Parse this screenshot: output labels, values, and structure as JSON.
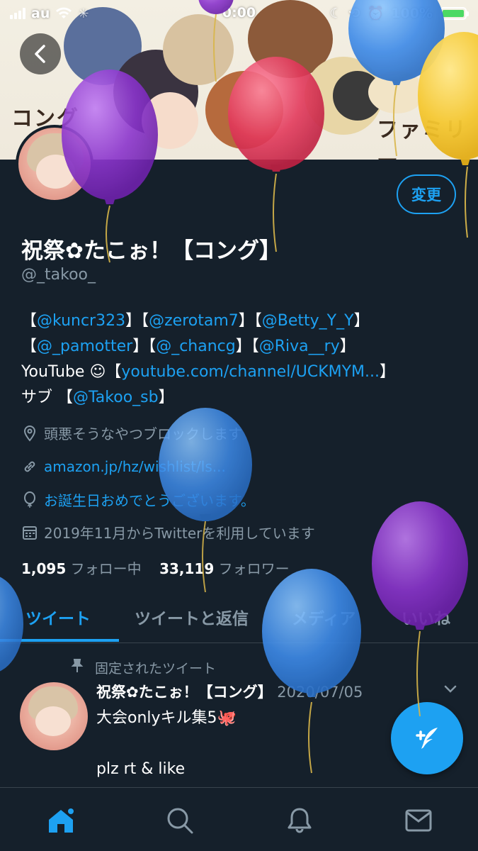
{
  "status_bar": {
    "carrier": "au",
    "time": "0:00",
    "battery": "100%",
    "battery_fill": 1.0
  },
  "banner": {
    "text_left": "コング",
    "text_right": "ファミリー"
  },
  "profile": {
    "name": "祝祭✿たこぉ！【コング】",
    "handle": "@_takoo_",
    "edit_button": "変更",
    "bio": {
      "line1": [
        {
          "t": "【",
          "link": false
        },
        {
          "t": "@kuncr323",
          "link": true
        },
        {
          "t": "】【",
          "link": false
        },
        {
          "t": "@zerotam7",
          "link": true
        },
        {
          "t": "】【",
          "link": false
        },
        {
          "t": "@Betty_Y_Y",
          "link": true
        },
        {
          "t": "】",
          "link": false
        }
      ],
      "line2": [
        {
          "t": "【",
          "link": false
        },
        {
          "t": "@_pamotter",
          "link": true
        },
        {
          "t": "】【",
          "link": false
        },
        {
          "t": "@_chancg",
          "link": true
        },
        {
          "t": "】【",
          "link": false
        },
        {
          "t": "@Riva__ry",
          "link": true
        },
        {
          "t": "】",
          "link": false
        }
      ],
      "line3_prefix": "YouTube ☺【",
      "line3_link": "youtube.com/channel/UCKMYM...",
      "line3_suffix": "】",
      "line4_prefix": "サブ 【",
      "line4_link": "@Takoo_sb",
      "line4_suffix": "】"
    },
    "location": "頭悪そうなやつブロックします",
    "website": "amazon.jp/hz/wishlist/ls...",
    "birthday": "お誕生日おめでとうございます。",
    "joined": "2019年11月からTwitterを利用しています",
    "following_count": "1,095",
    "following_label": "フォロー中",
    "followers_count": "33,119",
    "followers_label": "フォロワー"
  },
  "tabs": [
    "ツイート",
    "ツイートと返信",
    "メディア",
    "いいね"
  ],
  "pinned_tweet": {
    "pinned_label": "固定されたツイート",
    "author": "祝祭✿たこぉ！【コング】",
    "date": "2020/07/05",
    "text": "大会onlyキル集5🐙\n\nplz rt & like"
  },
  "colors": {
    "background": "#15202b",
    "accent": "#1da1f2",
    "secondary_text": "#8899a6",
    "divider": "#38444d"
  },
  "icons": [
    "back-arrow-icon",
    "home-icon",
    "search-icon",
    "bell-icon",
    "mail-icon",
    "compose-icon",
    "location-icon",
    "link-icon",
    "balloon-icon",
    "calendar-icon",
    "pin-icon",
    "chevron-down-icon"
  ]
}
